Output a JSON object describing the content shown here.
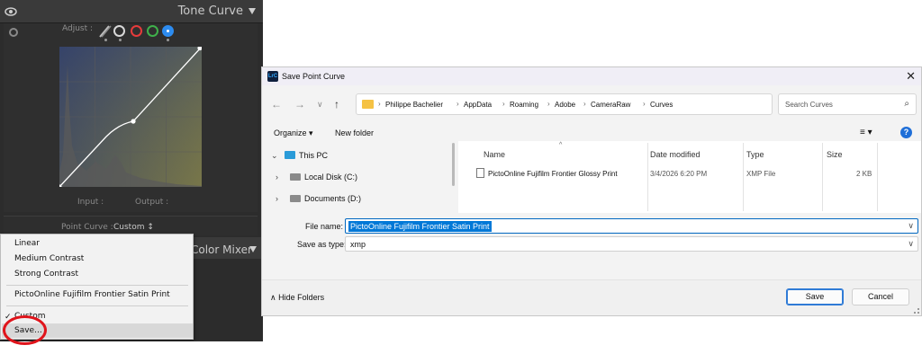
{
  "lightroom": {
    "panel_title": "Tone Curve",
    "adjust_label": "Adjust :",
    "input_label": "Input :",
    "output_label": "Output :",
    "point_curve_label": "Point Curve :",
    "point_curve_value": "Custom ↕",
    "color_mixer_title": "Color Mixer",
    "menu": {
      "items": [
        "Linear",
        "Medium Contrast",
        "Strong Contrast",
        "PictoOnline Fujifilm Frontier Satin Print",
        "Custom",
        "Save..."
      ],
      "checked_item": "Custom",
      "check_mark": "✓"
    },
    "channel_colors": [
      "#d8d8d8",
      "#e63b3b",
      "#3fb04b",
      "#2d8cf0"
    ],
    "highlight_ring_color": "#e0141b"
  },
  "dialog": {
    "title": "Save Point Curve",
    "app_icon_label": "LrC",
    "close": "✕",
    "nav": {
      "back": "←",
      "forward": "→",
      "up_menu": "∨",
      "up": "↑"
    },
    "breadcrumb": [
      "Philippe Bachelier",
      "AppData",
      "Roaming",
      "Adobe",
      "CameraRaw",
      "Curves"
    ],
    "breadcrumb_sep": "›",
    "refresh": "↻",
    "search_placeholder": "Search Curves",
    "search_icon": "⌕",
    "toolbar": {
      "organize": "Organize ▾",
      "new_folder": "New folder",
      "view": "≡ ▾",
      "help": "?"
    },
    "nav_pane": [
      {
        "label": "This PC",
        "chev": "⌄"
      },
      {
        "label": "Local Disk (C:)",
        "chev": "›"
      },
      {
        "label": "Documents (D:)",
        "chev": "›"
      }
    ],
    "columns": [
      "Name",
      "Date modified",
      "Type",
      "Size"
    ],
    "files": [
      {
        "name": "PictoOnline Fujifilm Frontier Glossy Print",
        "date": "3/4/2026 6:20 PM",
        "type": "XMP File",
        "size": "2 KB"
      }
    ],
    "file_name_label": "File name:",
    "file_name_value": "PictoOnline Fujifilm Frontier Satin Print",
    "save_type_label": "Save as type:",
    "save_type_value": "xmp",
    "dropdown_chev": "∨",
    "hide_folders": "∧ Hide Folders",
    "save_button": "Save",
    "cancel_button": "Cancel"
  }
}
